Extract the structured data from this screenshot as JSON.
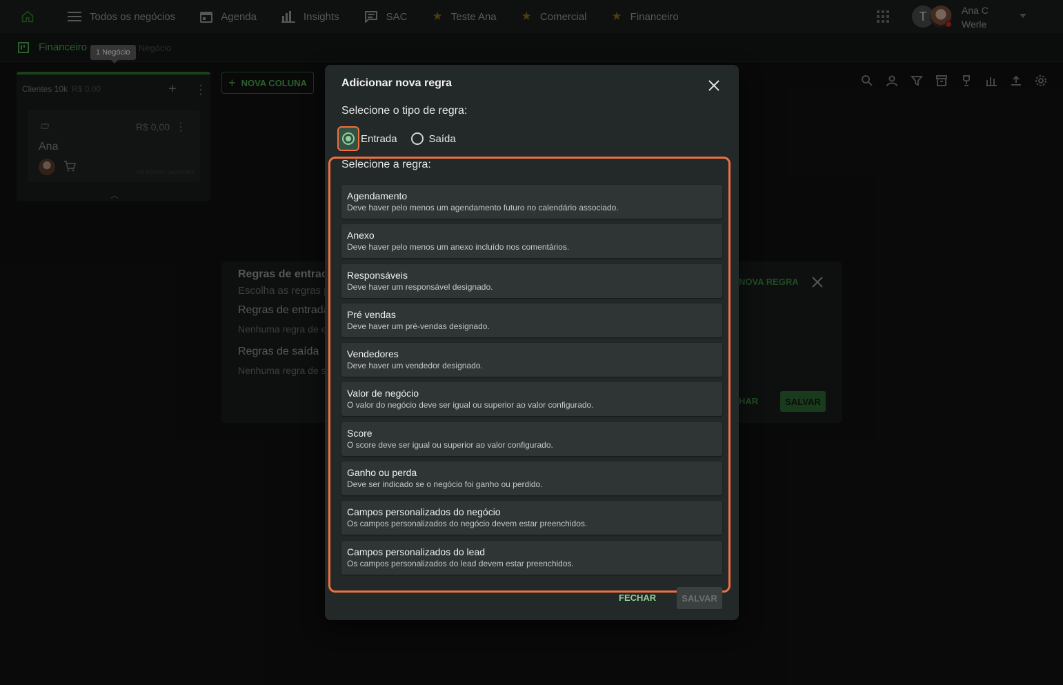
{
  "nav": {
    "items": [
      {
        "label": "Todos os negócios",
        "icon": "menu-icon"
      },
      {
        "label": "Agenda",
        "icon": "calendar-icon"
      },
      {
        "label": "Insights",
        "icon": "bar-chart-icon"
      },
      {
        "label": "SAC",
        "icon": "chat-icon"
      },
      {
        "label": "Teste Ana",
        "icon": "star-icon"
      },
      {
        "label": "Comercial",
        "icon": "star-icon"
      },
      {
        "label": "Financeiro",
        "icon": "star-icon"
      }
    ],
    "user_initial": "T",
    "user_name_line1": "Ana C",
    "user_name_line2": "Werle"
  },
  "subbar": {
    "board_title": "Financeiro",
    "board_sub": "1 Negócio",
    "tooltip": "1 Negócio"
  },
  "board": {
    "column_title": "Clientes 10k",
    "column_total": "R$ 0,00",
    "card_value": "R$ 0,00",
    "card_name": "Ana",
    "card_time": "Há poucos segundos",
    "new_column_label": "NOVA COLUNA"
  },
  "rules_panel": {
    "title_entry": "Regras de entrada",
    "sub_entry": "Escolha as regras p",
    "title_entry2": "Regras de entrada",
    "empty_entry": "Nenhuma regra de e",
    "title_exit": "Regras de saída",
    "empty_exit": "Nenhuma regra de s",
    "new_rule": "NOVA REGRA",
    "close_label": "HAR",
    "save_label": "SALVAR"
  },
  "dialog": {
    "title": "Adicionar nova regra",
    "type_label": "Selecione o tipo de regra:",
    "type_options": [
      "Entrada",
      "Saída"
    ],
    "selected_type": "Entrada",
    "rules_label": "Selecione a regra:",
    "rules": [
      {
        "title": "Agendamento",
        "desc": "Deve haver pelo menos um agendamento futuro no calendário associado."
      },
      {
        "title": "Anexo",
        "desc": "Deve haver pelo menos um anexo incluído nos comentários."
      },
      {
        "title": "Responsáveis",
        "desc": "Deve haver um responsável designado."
      },
      {
        "title": "Pré vendas",
        "desc": "Deve haver um pré-vendas designado."
      },
      {
        "title": "Vendedores",
        "desc": "Deve haver um vendedor designado."
      },
      {
        "title": "Valor de negócio",
        "desc": "O valor do negócio deve ser igual ou superior ao valor configurado."
      },
      {
        "title": "Score",
        "desc": "O score deve ser igual ou superior ao valor configurado."
      },
      {
        "title": "Ganho ou perda",
        "desc": "Deve ser indicado se o negócio foi ganho ou perdido."
      },
      {
        "title": "Campos personalizados do negócio",
        "desc": "Os campos personalizados do negócio devem estar preenchidos."
      },
      {
        "title": "Campos personalizados do lead",
        "desc": "Os campos personalizados do lead devem estar preenchidos."
      }
    ],
    "close_button": "FECHAR",
    "save_button": "SALVAR"
  },
  "colors": {
    "accent": "#4caf50",
    "highlight": "#f07040",
    "dialog_bg": "#232828"
  }
}
